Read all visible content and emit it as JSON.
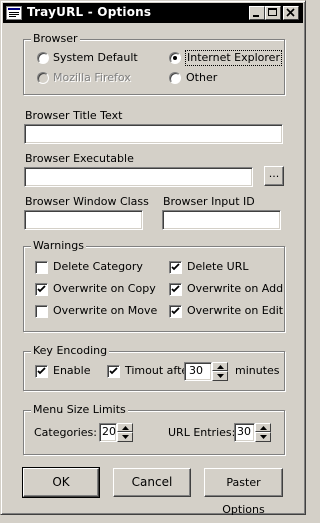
{
  "window": {
    "title": "TrayURL - Options",
    "icon": "trayurl-app-icon",
    "controls": [
      "minimize-icon",
      "maximize-icon",
      "close-icon"
    ]
  },
  "browser": {
    "legend": "Browser",
    "options": {
      "system_default": {
        "label": "System Default",
        "selected": false,
        "enabled": true
      },
      "internet_explorer": {
        "label": "Internet Explorer",
        "selected": true,
        "enabled": true
      },
      "mozilla_firefox": {
        "label": "Mozilla Firefox",
        "selected": false,
        "enabled": false
      },
      "other": {
        "label": "Other",
        "selected": false,
        "enabled": true
      }
    }
  },
  "fields": {
    "title_text_label": "Browser Title Text",
    "title_text_value": "",
    "executable_label": "Browser Executable",
    "executable_value": "",
    "browse_label": "...",
    "window_class_label": "Browser Window Class",
    "window_class_value": "",
    "input_id_label": "Browser Input ID",
    "input_id_value": ""
  },
  "warnings": {
    "legend": "Warnings",
    "items": {
      "delete_category": {
        "label": "Delete Category",
        "checked": false
      },
      "delete_url": {
        "label": "Delete URL",
        "checked": true
      },
      "overwrite_copy": {
        "label": "Overwrite on Copy",
        "checked": true
      },
      "overwrite_add": {
        "label": "Overwrite on Add",
        "checked": true
      },
      "overwrite_move": {
        "label": "Overwrite on Move",
        "checked": false
      },
      "overwrite_edit": {
        "label": "Overwrite on Edit",
        "checked": true
      }
    }
  },
  "key_encoding": {
    "legend": "Key Encoding",
    "enable_label": "Enable",
    "enable_checked": true,
    "timeout_label": "Timout after",
    "timeout_checked": true,
    "timeout_value": "30",
    "minutes_label": "minutes"
  },
  "menu_size": {
    "legend": "Menu Size Limits",
    "categories_label": "Categories:",
    "categories_value": "20",
    "url_entries_label": "URL Entries:",
    "url_entries_value": "30"
  },
  "buttons": {
    "ok": "OK",
    "cancel": "Cancel",
    "paster": "Paster Options"
  },
  "colors": {
    "face": "#d4d0c8",
    "titlebar": "#000000",
    "disabled_text": "#808080"
  }
}
